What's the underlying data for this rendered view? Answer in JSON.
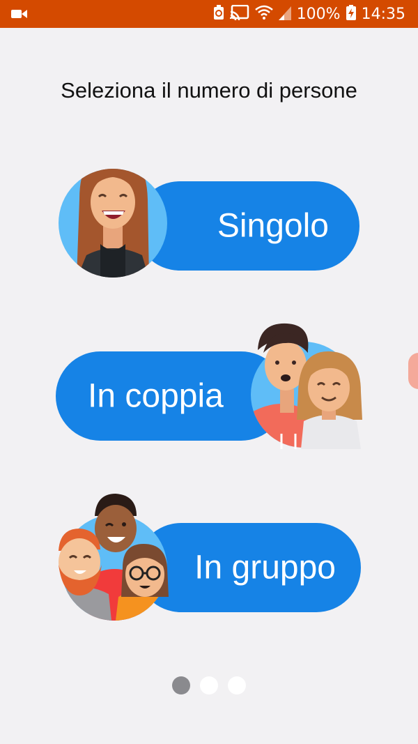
{
  "status_bar": {
    "battery": "100%",
    "time": "14:35",
    "color": "#d44a00"
  },
  "title": "Seleziona il numero di persone",
  "options": [
    {
      "label": "Singolo",
      "avatar": "single-person-avatar-icon"
    },
    {
      "label": "In coppia",
      "avatar": "couple-avatar-icon"
    },
    {
      "label": "In gruppo",
      "avatar": "group-avatar-icon"
    }
  ],
  "pager": {
    "pages": 3,
    "active": 1
  },
  "accent_color": "#1683e6"
}
